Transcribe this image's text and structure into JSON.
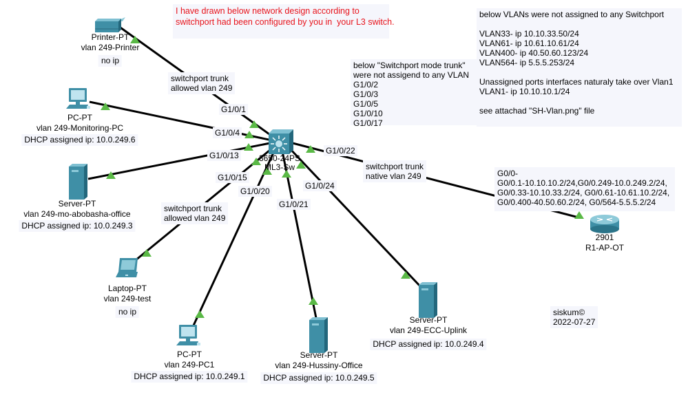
{
  "colors": {
    "link": "#000000",
    "link_up_triangle": "#5ab946",
    "note_bg": "#f5f6fc",
    "note_red": "#e8141c",
    "device_teal": "#3f8fa6"
  },
  "notes": {
    "intro": "I have drawn below network design according to\nswitchport had been configured by you in  your L3 switch.",
    "trunk_unassigned": "below \"Switchport mode trunk\"\nwere not assigend to any VLAN\nG1/0/2\nG1/0/3\nG1/0/5\nG1/0/10\nG1/0/17",
    "vlans_unassigned": "below VLANs were not assigned to any Switchport\n\nVLAN33- ip 10.10.33.50/24\nVLAN61- ip 10.61.10.61/24\nVLAN400- ip 40.50.60.123/24\nVLAN564- ip 5.5.5.253/24\n\nUnassigned ports interfaces naturaly take over Vlan1\nVLAN1- ip 10.10.10.1/24\n\nsee attachad \"SH-Vlan.png\" file",
    "router_subifs": "G0/0-\nG0/0.1-10.10.10.2/24,G0/0.249-10.0.249.2/24,\nG0/0.33-10.10.33.2/24, G0/0.61-10.61.10.2/24,\nG0/0.400-40.50.60.2/24, G0/564-5.5.5.2/24",
    "signature": "siskum©\n2022-07-27"
  },
  "link_notes": {
    "printer_trunk": "switchport trunk\nallowed vlan 249",
    "laptop_trunk": "switchport trunk\nallowed vlan 249",
    "router_trunk": "switchport trunk\nnative vlan 249"
  },
  "switch": {
    "model": "3650-24PS",
    "name": "ML3-Sw",
    "icon": "multilayer-switch-icon"
  },
  "ports": {
    "printer": "G1/0/1",
    "monitoring_pc": "G1/0/4",
    "server_abobasha": "G1/0/13",
    "laptop": "G1/0/15",
    "pc1": "G1/0/20",
    "server_hussiny": "G1/0/21",
    "router": "G1/0/22",
    "server_ecc": "G1/0/24"
  },
  "devices": {
    "printer": {
      "type": "Printer-PT",
      "name": "vlan 249-Printer",
      "ip": "no ip",
      "icon": "printer-icon"
    },
    "monitoring_pc": {
      "type": "PC-PT",
      "name": "vlan 249-Monitoring-PC",
      "ip": "DHCP assigned ip: 10.0.249.6",
      "icon": "pc-icon"
    },
    "server_abobasha": {
      "type": "Server-PT",
      "name": "vlan 249-mo-abobasha-office",
      "ip": "DHCP assigned ip: 10.0.249.3",
      "icon": "server-icon"
    },
    "laptop": {
      "type": "Laptop-PT",
      "name": "vlan 249-test",
      "ip": "no ip",
      "icon": "laptop-icon"
    },
    "pc1": {
      "type": "PC-PT",
      "name": "vlan 249-PC1",
      "ip": "DHCP assigned ip: 10.0.249.1",
      "icon": "pc-icon"
    },
    "server_hussiny": {
      "type": "Server-PT",
      "name": "vlan 249-Hussiny-Office",
      "ip": "DHCP assigned ip: 10.0.249.5",
      "icon": "server-icon"
    },
    "server_ecc": {
      "type": "Server-PT",
      "name": "vlan 249-ECC-Uplink",
      "ip": "DHCP assigned ip: 10.0.249.4",
      "icon": "server-icon"
    },
    "router": {
      "type": "2901",
      "name": "R1-AP-OT",
      "icon": "router-icon"
    }
  }
}
